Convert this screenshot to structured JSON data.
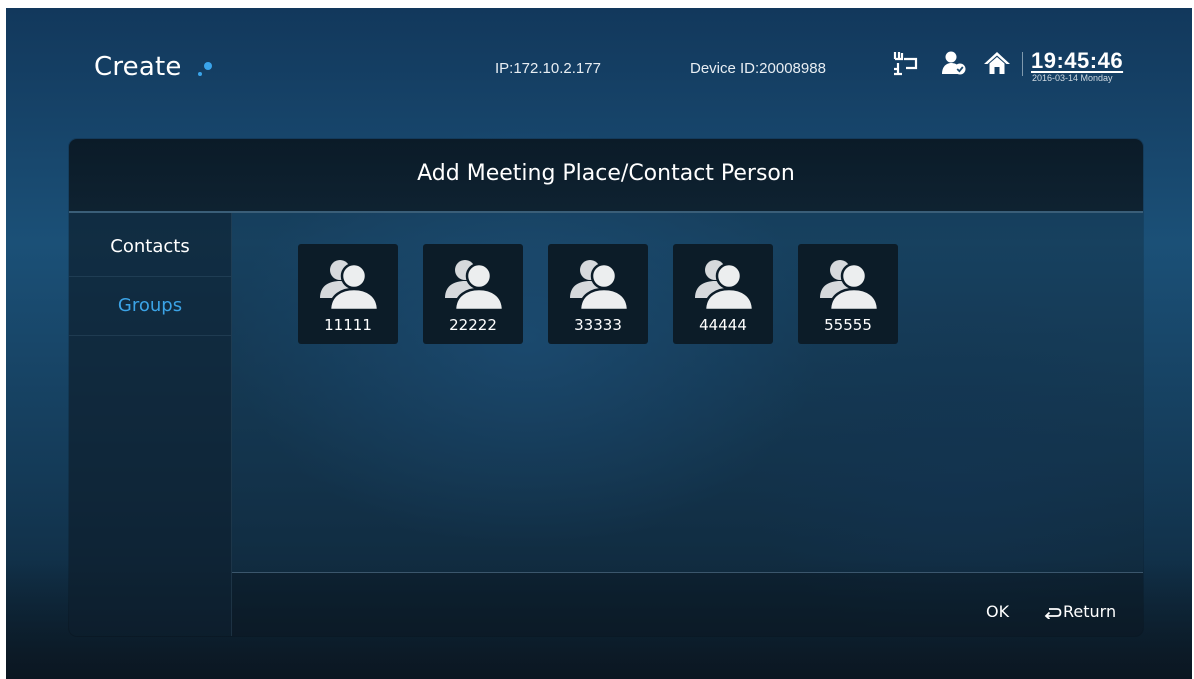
{
  "header": {
    "logo_text": "Create",
    "ip_text": "IP:172.10.2.177",
    "device_text": "Device ID:20008988",
    "time": "19:45:46",
    "date": "2016-03-14 Monday",
    "icons": [
      "network-icon",
      "user-status-icon",
      "home-icon"
    ]
  },
  "panel": {
    "title": "Add Meeting Place/Contact Person"
  },
  "sidebar": {
    "items": [
      {
        "label": "Contacts",
        "active": false
      },
      {
        "label": "Groups",
        "active": true
      }
    ]
  },
  "groups": [
    {
      "name": "11111",
      "icon": "group-icon"
    },
    {
      "name": "22222",
      "icon": "group-icon"
    },
    {
      "name": "33333",
      "icon": "group-icon"
    },
    {
      "name": "44444",
      "icon": "group-icon"
    },
    {
      "name": "55555",
      "icon": "group-icon"
    }
  ],
  "footer": {
    "ok_label": "OK",
    "return_label": "Return"
  },
  "colors": {
    "accent": "#3ba3e6",
    "header_bg": "#0b1b28",
    "tile_bg": "#0c1c28"
  }
}
